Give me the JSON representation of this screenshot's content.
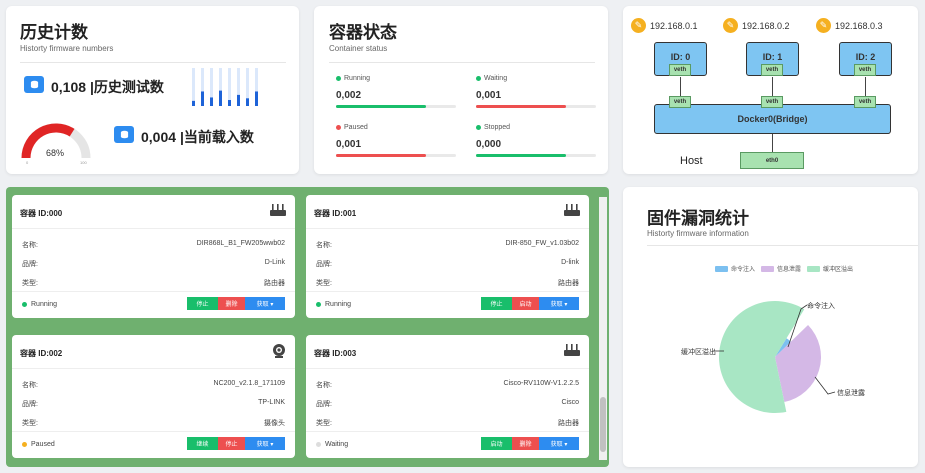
{
  "history": {
    "title": "历史计数",
    "subtitle": "Historty firmware numbers",
    "tested_count": "0,108",
    "tested_label": "|历史测试数",
    "loaded_count": "0,004",
    "loaded_label": "|当前载入数",
    "gauge_value": "68%",
    "gauge_percent": 68
  },
  "container_status": {
    "title": "容器状态",
    "subtitle": "Container status",
    "items": [
      {
        "label": "Running",
        "value": "0,002",
        "color": "#19be6b",
        "fill": 0.75
      },
      {
        "label": "Waiting",
        "value": "0,001",
        "color": "#ed4f4f",
        "fill": 0.75
      },
      {
        "label": "Paused",
        "value": "0,001",
        "color": "#ed4f4f",
        "fill": 0.75
      },
      {
        "label": "Stopped",
        "value": "0,000",
        "color": "#19be6b",
        "fill": 0.75
      }
    ]
  },
  "network": {
    "ips": [
      "192.168.0.1",
      "192.168.0.2",
      "192.168.0.3"
    ],
    "nodes": [
      "ID: 0",
      "ID: 1",
      "ID: 2"
    ],
    "veth": "veth",
    "bridge": "Docker0(Bridge)",
    "host": "Host",
    "eth": "eth0"
  },
  "containers": [
    {
      "title": "容器 ID:000",
      "name_label": "名称:",
      "name": "DIR868L_B1_FW205wwb02",
      "brand_label": "品牌:",
      "brand": "D-Link",
      "type_label": "类型:",
      "type": "路由器",
      "status": "Running",
      "status_color": "#19be6b",
      "btn1": "停止",
      "btn2": "删除",
      "btn3": "获取 ▾",
      "btn1_color": "#19be6b",
      "icon": "router-icon"
    },
    {
      "title": "容器 ID:001",
      "name_label": "名称:",
      "name": "DIR-850_FW_v1.03b02",
      "brand_label": "品牌:",
      "brand": "D-link",
      "type_label": "类型:",
      "type": "路由器",
      "status": "Running",
      "status_color": "#19be6b",
      "btn1": "停止",
      "btn2": "启动",
      "btn3": "获取 ▾",
      "btn1_color": "#19be6b",
      "icon": "router-icon"
    },
    {
      "title": "容器 ID:002",
      "name_label": "名称:",
      "name": "NC200_v2.1.8_171109",
      "brand_label": "品牌:",
      "brand": "TP-LINK",
      "type_label": "类型:",
      "type": "摄像头",
      "status": "Paused",
      "status_color": "#f5b020",
      "btn1": "继续",
      "btn2": "停止",
      "btn3": "获取 ▾",
      "btn1_color": "#19be6b",
      "icon": "camera-icon"
    },
    {
      "title": "容器 ID:003",
      "name_label": "名称:",
      "name": "Cisco-RV110W-V1.2.2.5",
      "brand_label": "品牌:",
      "brand": "Cisco",
      "type_label": "类型:",
      "type": "路由器",
      "status": "Waiting",
      "status_color": "#dddddd",
      "btn1": "启动",
      "btn2": "删除",
      "btn3": "获取 ▾",
      "btn1_color": "#19be6b",
      "icon": "router-icon"
    }
  ],
  "vuln": {
    "title": "固件漏洞统计",
    "subtitle": "Historty firmware information"
  },
  "chart_data": {
    "type": "pie",
    "title": "固件漏洞统计",
    "legend": [
      "命令注入",
      "信息泄露",
      "缓冲区溢出"
    ],
    "colors": [
      "#7cc0f0",
      "#d4b8e6",
      "#a8e6c4"
    ],
    "values": [
      4,
      34,
      62
    ],
    "legend_position": "top"
  }
}
